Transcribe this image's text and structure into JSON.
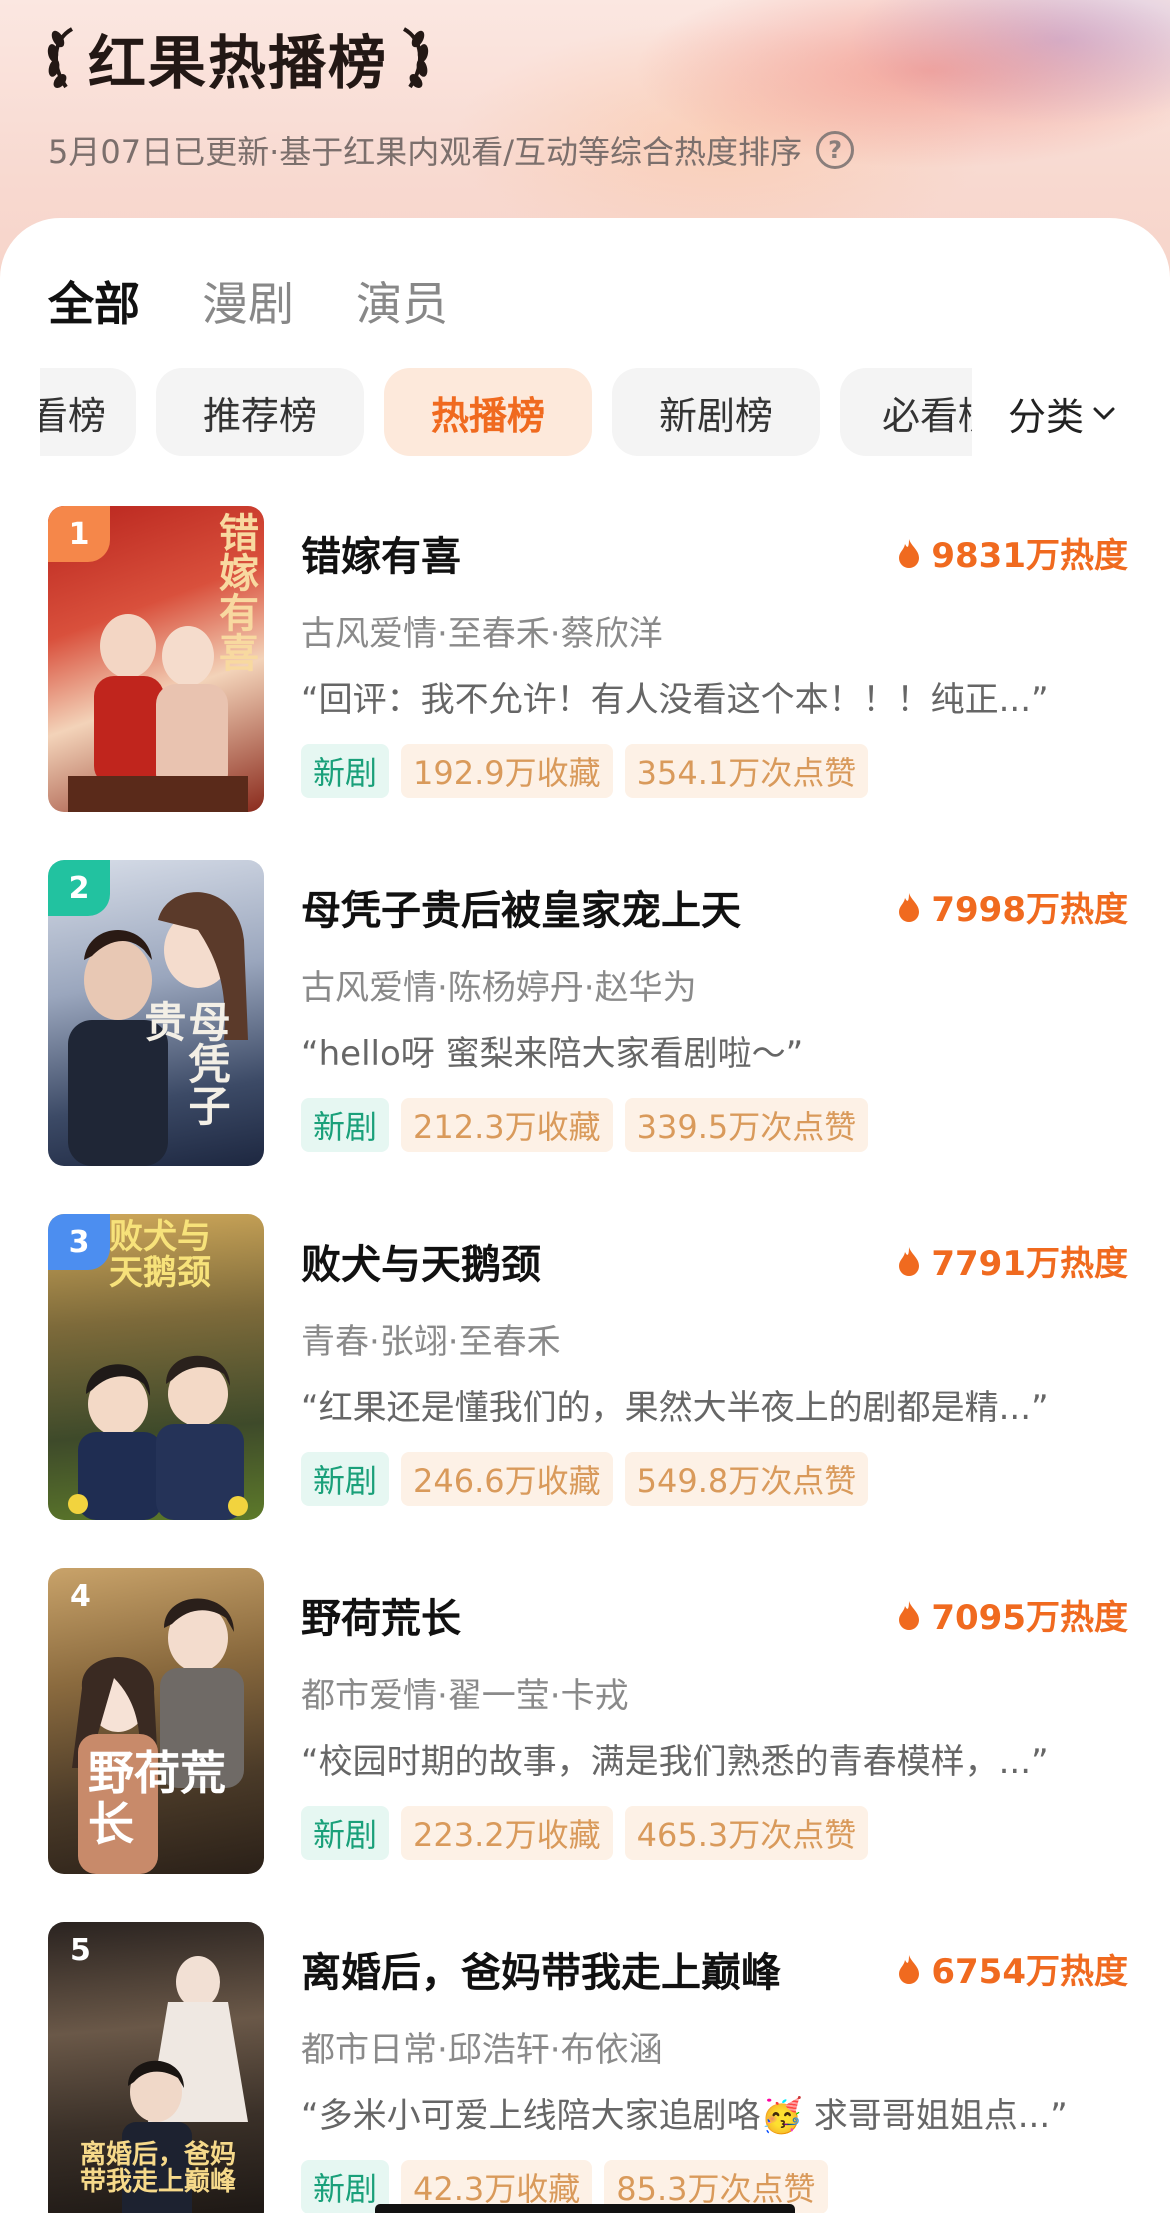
{
  "header": {
    "title": "红果热播榜",
    "subtitle": "5月07日已更新·基于红果内观看/互动等综合热度排序",
    "help_icon": "question-circle-icon"
  },
  "main_tabs": [
    {
      "label": "全部",
      "active": true
    },
    {
      "label": "漫剧",
      "active": false
    },
    {
      "label": "演员",
      "active": false
    }
  ],
  "rank_tabs": [
    {
      "label": "必看榜",
      "active": false
    },
    {
      "label": "推荐榜",
      "active": false
    },
    {
      "label": "热播榜",
      "active": true
    },
    {
      "label": "新剧榜",
      "active": false
    },
    {
      "label": "必看榜",
      "active": false
    }
  ],
  "category": {
    "label": "分类",
    "icon": "chevron-down-icon"
  },
  "colors": {
    "accent": "#f06a1f",
    "new_tag_text": "#1aa07a",
    "new_tag_bg": "#e6f7f2",
    "stat_tag_text": "#d99a5b",
    "stat_tag_bg": "#fdf1e6",
    "rank1": "#f5874a",
    "rank2": "#22c2a0",
    "rank3": "#4c8ef0"
  },
  "items": [
    {
      "rank": "1",
      "title": "错嫁有喜",
      "heat": "9831万热度",
      "meta": "古风爱情·至春禾·蔡欣洋",
      "quote": "“回评：我不允许！有人没看这个本！！！纯正...”",
      "tag_new": "新剧",
      "favorites": "192.9万收藏",
      "likes": "354.1万次点赞",
      "poster_text": "错嫁有喜"
    },
    {
      "rank": "2",
      "title": "母凭子贵后被皇家宠上天",
      "heat": "7998万热度",
      "meta": "古风爱情·陈杨婷丹·赵华为",
      "quote": "“hello呀 蜜梨来陪大家看剧啦～”",
      "tag_new": "新剧",
      "favorites": "212.3万收藏",
      "likes": "339.5万次点赞",
      "poster_text": "母凭子贵"
    },
    {
      "rank": "3",
      "title": "败犬与天鹅颈",
      "heat": "7791万热度",
      "meta": "青春·张翊·至春禾",
      "quote": "“红果还是懂我们的，果然大半夜上的剧都是精...”",
      "tag_new": "新剧",
      "favorites": "246.6万收藏",
      "likes": "549.8万次点赞",
      "poster_text": "败犬与天鹅颈"
    },
    {
      "rank": "4",
      "title": "野荷荒长",
      "heat": "7095万热度",
      "meta": "都市爱情·翟一莹·卡戎",
      "quote": "“校园时期的故事，满是我们熟悉的青春模样，...”",
      "tag_new": "新剧",
      "favorites": "223.2万收藏",
      "likes": "465.3万次点赞",
      "poster_text": "野荷荒长"
    },
    {
      "rank": "5",
      "title": "离婚后，爸妈带我走上巅峰",
      "heat": "6754万热度",
      "meta": "都市日常·邱浩轩·布依涵",
      "quote": "“多米小可爱上线陪大家追剧咯🥳 求哥哥姐姐点...”",
      "tag_new": "新剧",
      "favorites": "42.3万收藏",
      "likes": "85.3万次点赞",
      "poster_text": "离婚后，爸妈带我走上巅峰"
    }
  ]
}
